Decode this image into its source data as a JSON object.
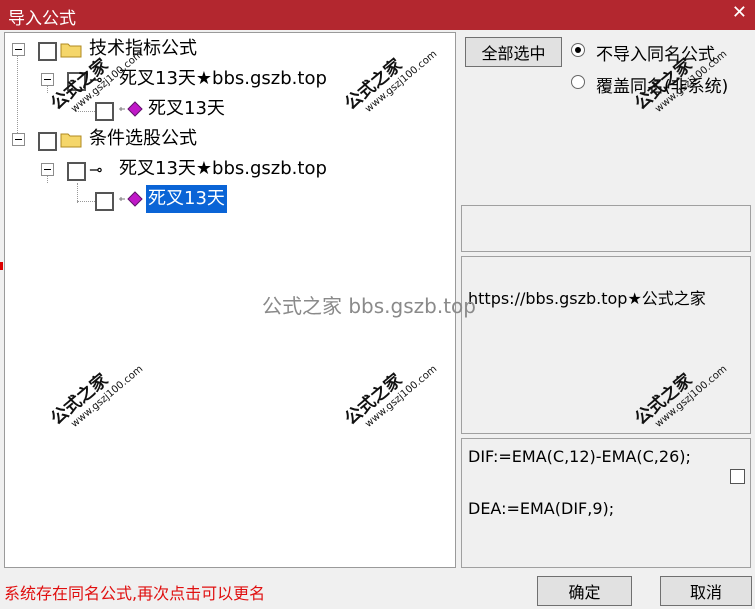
{
  "window": {
    "title": "导入公式",
    "close_label": "✕"
  },
  "tree": {
    "groups": [
      {
        "label": "技术指标公式",
        "formula_label": "死叉13天★bbs.gszb.top",
        "item_label": "死叉13天"
      },
      {
        "label": "条件选股公式",
        "formula_label": "死叉13天★bbs.gszb.top",
        "item_label": "死叉13天"
      }
    ]
  },
  "options": {
    "select_all_label": "全部选中",
    "radio_no_import_label": "不导入同名公式",
    "radio_overwrite_label": "覆盖同名(非系统)",
    "selected": "no_import"
  },
  "description": "https://bbs.gszb.top★公式之家",
  "code": {
    "line1": "DIF:=EMA(C,12)-EMA(C,26);",
    "line2": "DEA:=EMA(DIF,9);"
  },
  "watermark": {
    "brand": "公式之家",
    "site": "www.gszj100.com",
    "center_text": "公式之家 bbs.gszb.top"
  },
  "status_text": "系统存在同名公式,再次点击可以更名",
  "buttons": {
    "ok_label": "确定",
    "cancel_label": "取消"
  }
}
